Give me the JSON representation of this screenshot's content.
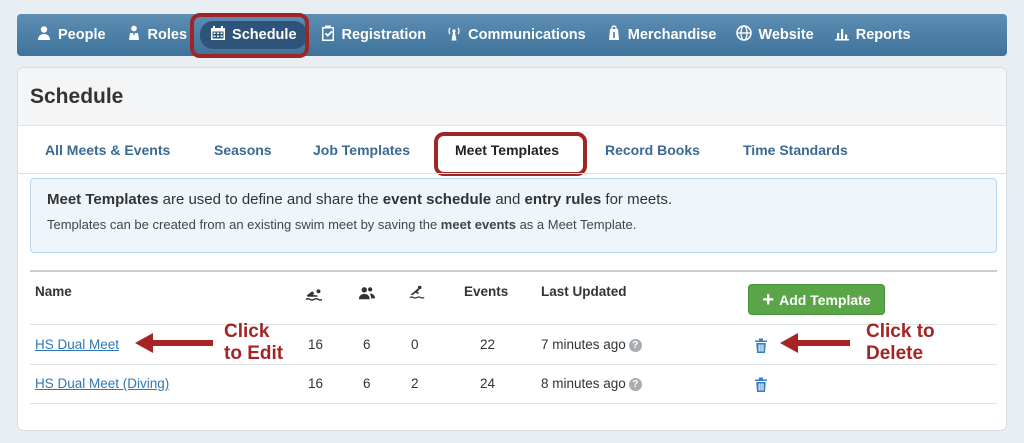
{
  "nav": {
    "items": [
      {
        "label": "People",
        "icon": "person-icon"
      },
      {
        "label": "Roles",
        "icon": "role-icon"
      },
      {
        "label": "Schedule",
        "icon": "calendar-icon",
        "active": true
      },
      {
        "label": "Registration",
        "icon": "clipboard-check-icon"
      },
      {
        "label": "Communications",
        "icon": "broadcast-icon"
      },
      {
        "label": "Merchandise",
        "icon": "bag-icon"
      },
      {
        "label": "Website",
        "icon": "globe-icon"
      },
      {
        "label": "Reports",
        "icon": "bar-chart-icon"
      }
    ]
  },
  "page": {
    "title": "Schedule"
  },
  "tabs": [
    {
      "label": "All Meets & Events"
    },
    {
      "label": "Seasons"
    },
    {
      "label": "Job Templates"
    },
    {
      "label": "Meet Templates",
      "active": true
    },
    {
      "label": "Record Books"
    },
    {
      "label": "Time Standards"
    }
  ],
  "info": {
    "line1": {
      "b1": "Meet Templates",
      "t1": " are used to define and share the ",
      "b2": "event schedule",
      "t2": " and ",
      "b3": "entry rules",
      "t3": " for meets."
    },
    "line2": {
      "t1": "Templates can be created from an existing swim meet by saving the ",
      "b1": "meet events",
      "t2": " as a Meet Template."
    }
  },
  "table": {
    "headers": {
      "name": "Name",
      "events": "Events",
      "last_updated": "Last Updated"
    },
    "add_button": "Add Template",
    "rows": [
      {
        "name": "HS Dual Meet",
        "swimmers": "16",
        "coaches": "6",
        "divers": "0",
        "events": "22",
        "last_updated": "7 minutes ago"
      },
      {
        "name": "HS Dual Meet (Diving)",
        "swimmers": "16",
        "coaches": "6",
        "divers": "2",
        "events": "24",
        "last_updated": "8 minutes ago"
      }
    ],
    "help_glyph": "?"
  },
  "annotations": {
    "edit_line1": "Click",
    "edit_line2": "to Edit",
    "delete_line1": "Click to",
    "delete_line2": "Delete"
  },
  "colors": {
    "nav_bg": "#4a7ea6",
    "highlight": "#a02525",
    "link": "#2f77b5",
    "add_button": "#5aa548",
    "info_bg": "#eef6fc"
  }
}
